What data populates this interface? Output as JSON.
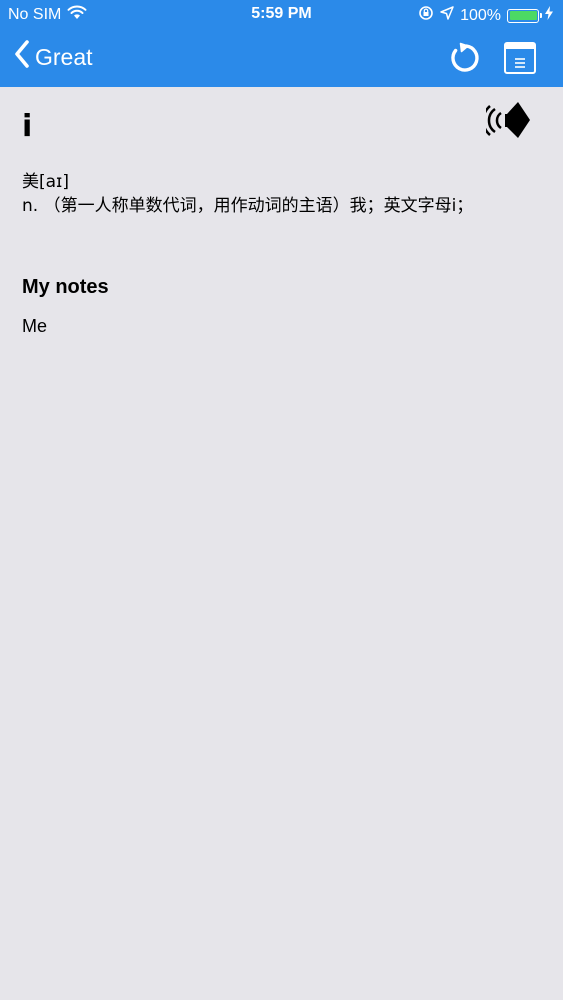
{
  "status_bar": {
    "carrier": "No SIM",
    "time": "5:59 PM",
    "battery_percent": "100%",
    "battery_level": 1.0,
    "battery_color": "#4cd964"
  },
  "nav": {
    "back_label": "Great",
    "refresh_icon": "refresh-icon",
    "book_icon": "book-icon",
    "bar_color": "#2b8ae9"
  },
  "entry": {
    "word": "i",
    "phonetic": "美[aɪ]",
    "definition": "n. （第一人称单数代词，用作动词的主语）我；英文字母i；",
    "speaker_icon": "speaker-icon"
  },
  "notes": {
    "heading": "My notes",
    "text": "Me"
  },
  "background_color": "#e6e5ea"
}
